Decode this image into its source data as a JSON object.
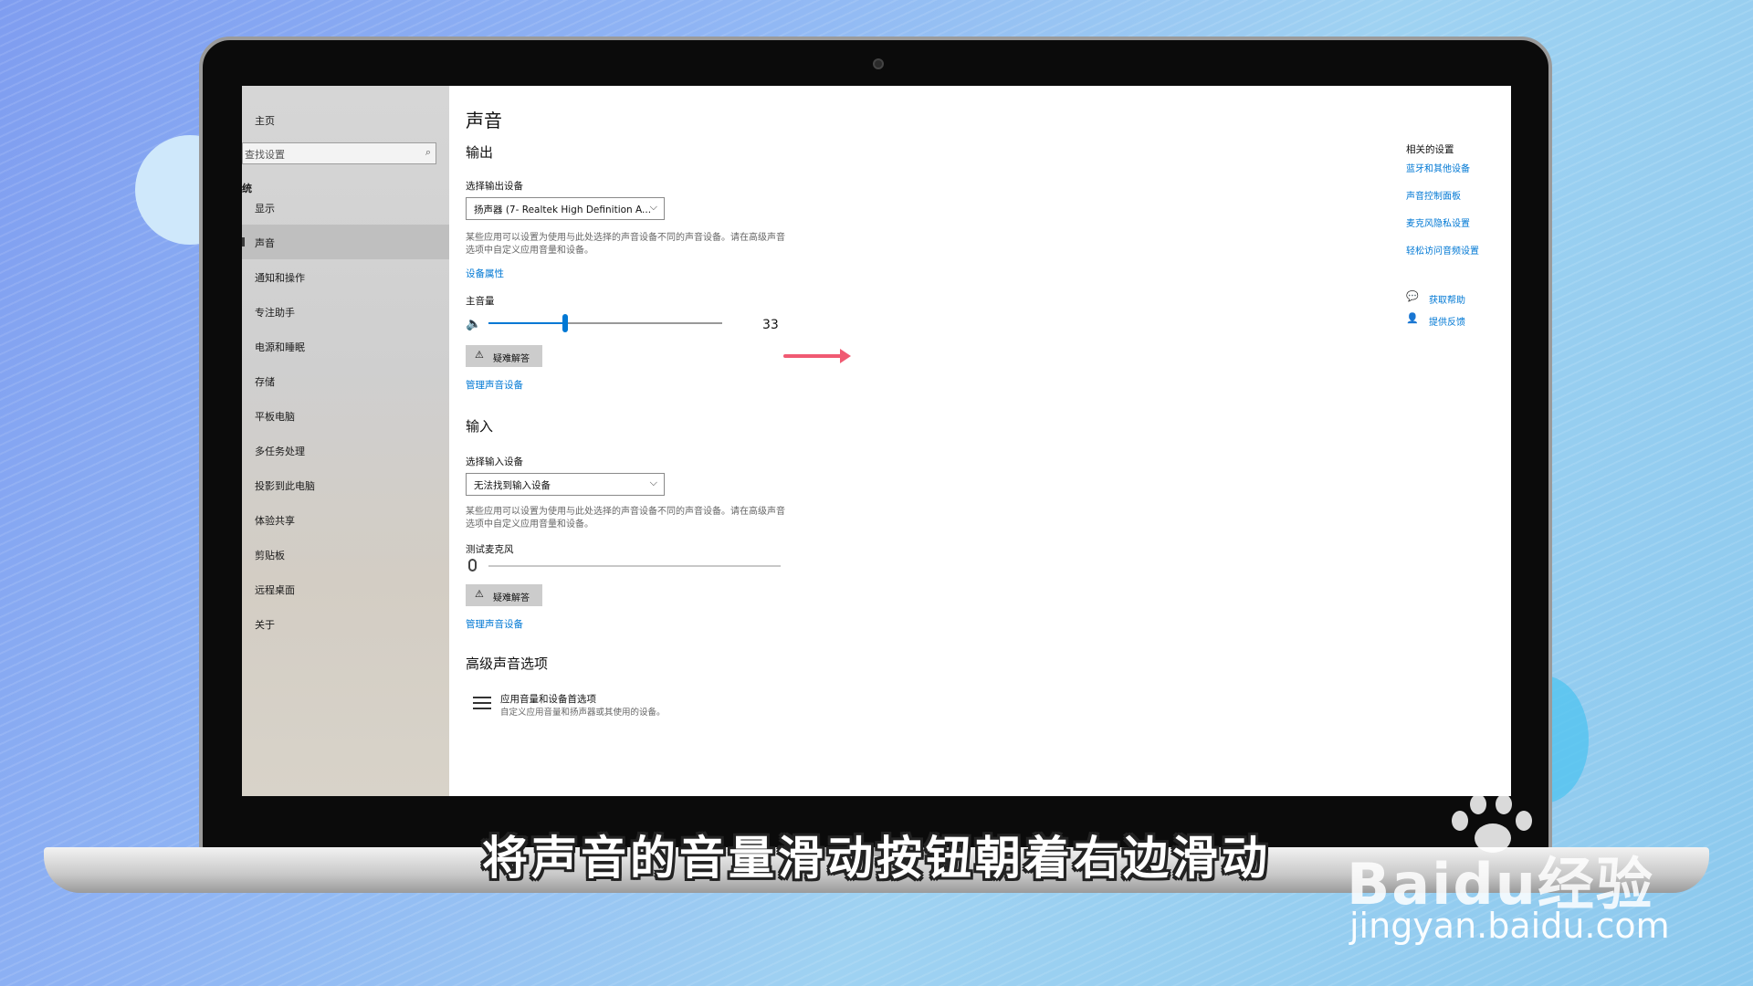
{
  "sidebar": {
    "home": "主页",
    "search_placeholder": "查找设置",
    "section": "统",
    "items": [
      {
        "label": "显示",
        "active": false
      },
      {
        "label": "声音",
        "active": true
      },
      {
        "label": "通知和操作",
        "active": false
      },
      {
        "label": "专注助手",
        "active": false
      },
      {
        "label": "电源和睡眠",
        "active": false
      },
      {
        "label": "存储",
        "active": false
      },
      {
        "label": "平板电脑",
        "active": false
      },
      {
        "label": "多任务处理",
        "active": false
      },
      {
        "label": "投影到此电脑",
        "active": false
      },
      {
        "label": "体验共享",
        "active": false
      },
      {
        "label": "剪贴板",
        "active": false
      },
      {
        "label": "远程桌面",
        "active": false
      },
      {
        "label": "关于",
        "active": false
      }
    ]
  },
  "main": {
    "title": "声音",
    "output": {
      "heading": "输出",
      "device_label": "选择输出设备",
      "device_value": "扬声器 (7- Realtek High Definition A...",
      "description": "某些应用可以设置为使用与此处选择的声音设备不同的声音设备。请在高级声音选项中自定义应用音量和设备。",
      "properties_link": "设备属性",
      "volume_label": "主音量",
      "volume_value": 33,
      "troubleshoot": "疑难解答",
      "manage_link": "管理声音设备"
    },
    "input": {
      "heading": "输入",
      "device_label": "选择输入设备",
      "device_value": "无法找到输入设备",
      "description": "某些应用可以设置为使用与此处选择的声音设备不同的声音设备。请在高级声音选项中自定义应用音量和设备。",
      "test_label": "测试麦克风",
      "troubleshoot": "疑难解答",
      "manage_link": "管理声音设备"
    },
    "advanced": {
      "heading": "高级声音选项",
      "item_title": "应用音量和设备首选项",
      "item_desc": "自定义应用音量和扬声器或其使用的设备。"
    }
  },
  "related": {
    "title": "相关的设置",
    "links": [
      "蓝牙和其他设备",
      "声音控制面板",
      "麦克风隐私设置",
      "轻松访问音频设置"
    ],
    "help": "获取帮助",
    "feedback": "提供反馈"
  },
  "overlay": {
    "subtitle": "将声音的音量滑动按钮朝着右边滑动",
    "watermark_brand": "Baidu经验",
    "watermark_url": "jingyan.baidu.com"
  },
  "colors": {
    "accent": "#0078d4",
    "arrow": "#f05a72"
  },
  "icons": {
    "search": "search-icon",
    "volume": "speaker-icon",
    "warning": "warning-icon",
    "microphone": "microphone-icon",
    "advanced": "sliders-icon",
    "help": "help-icon",
    "feedback": "feedback-icon"
  }
}
